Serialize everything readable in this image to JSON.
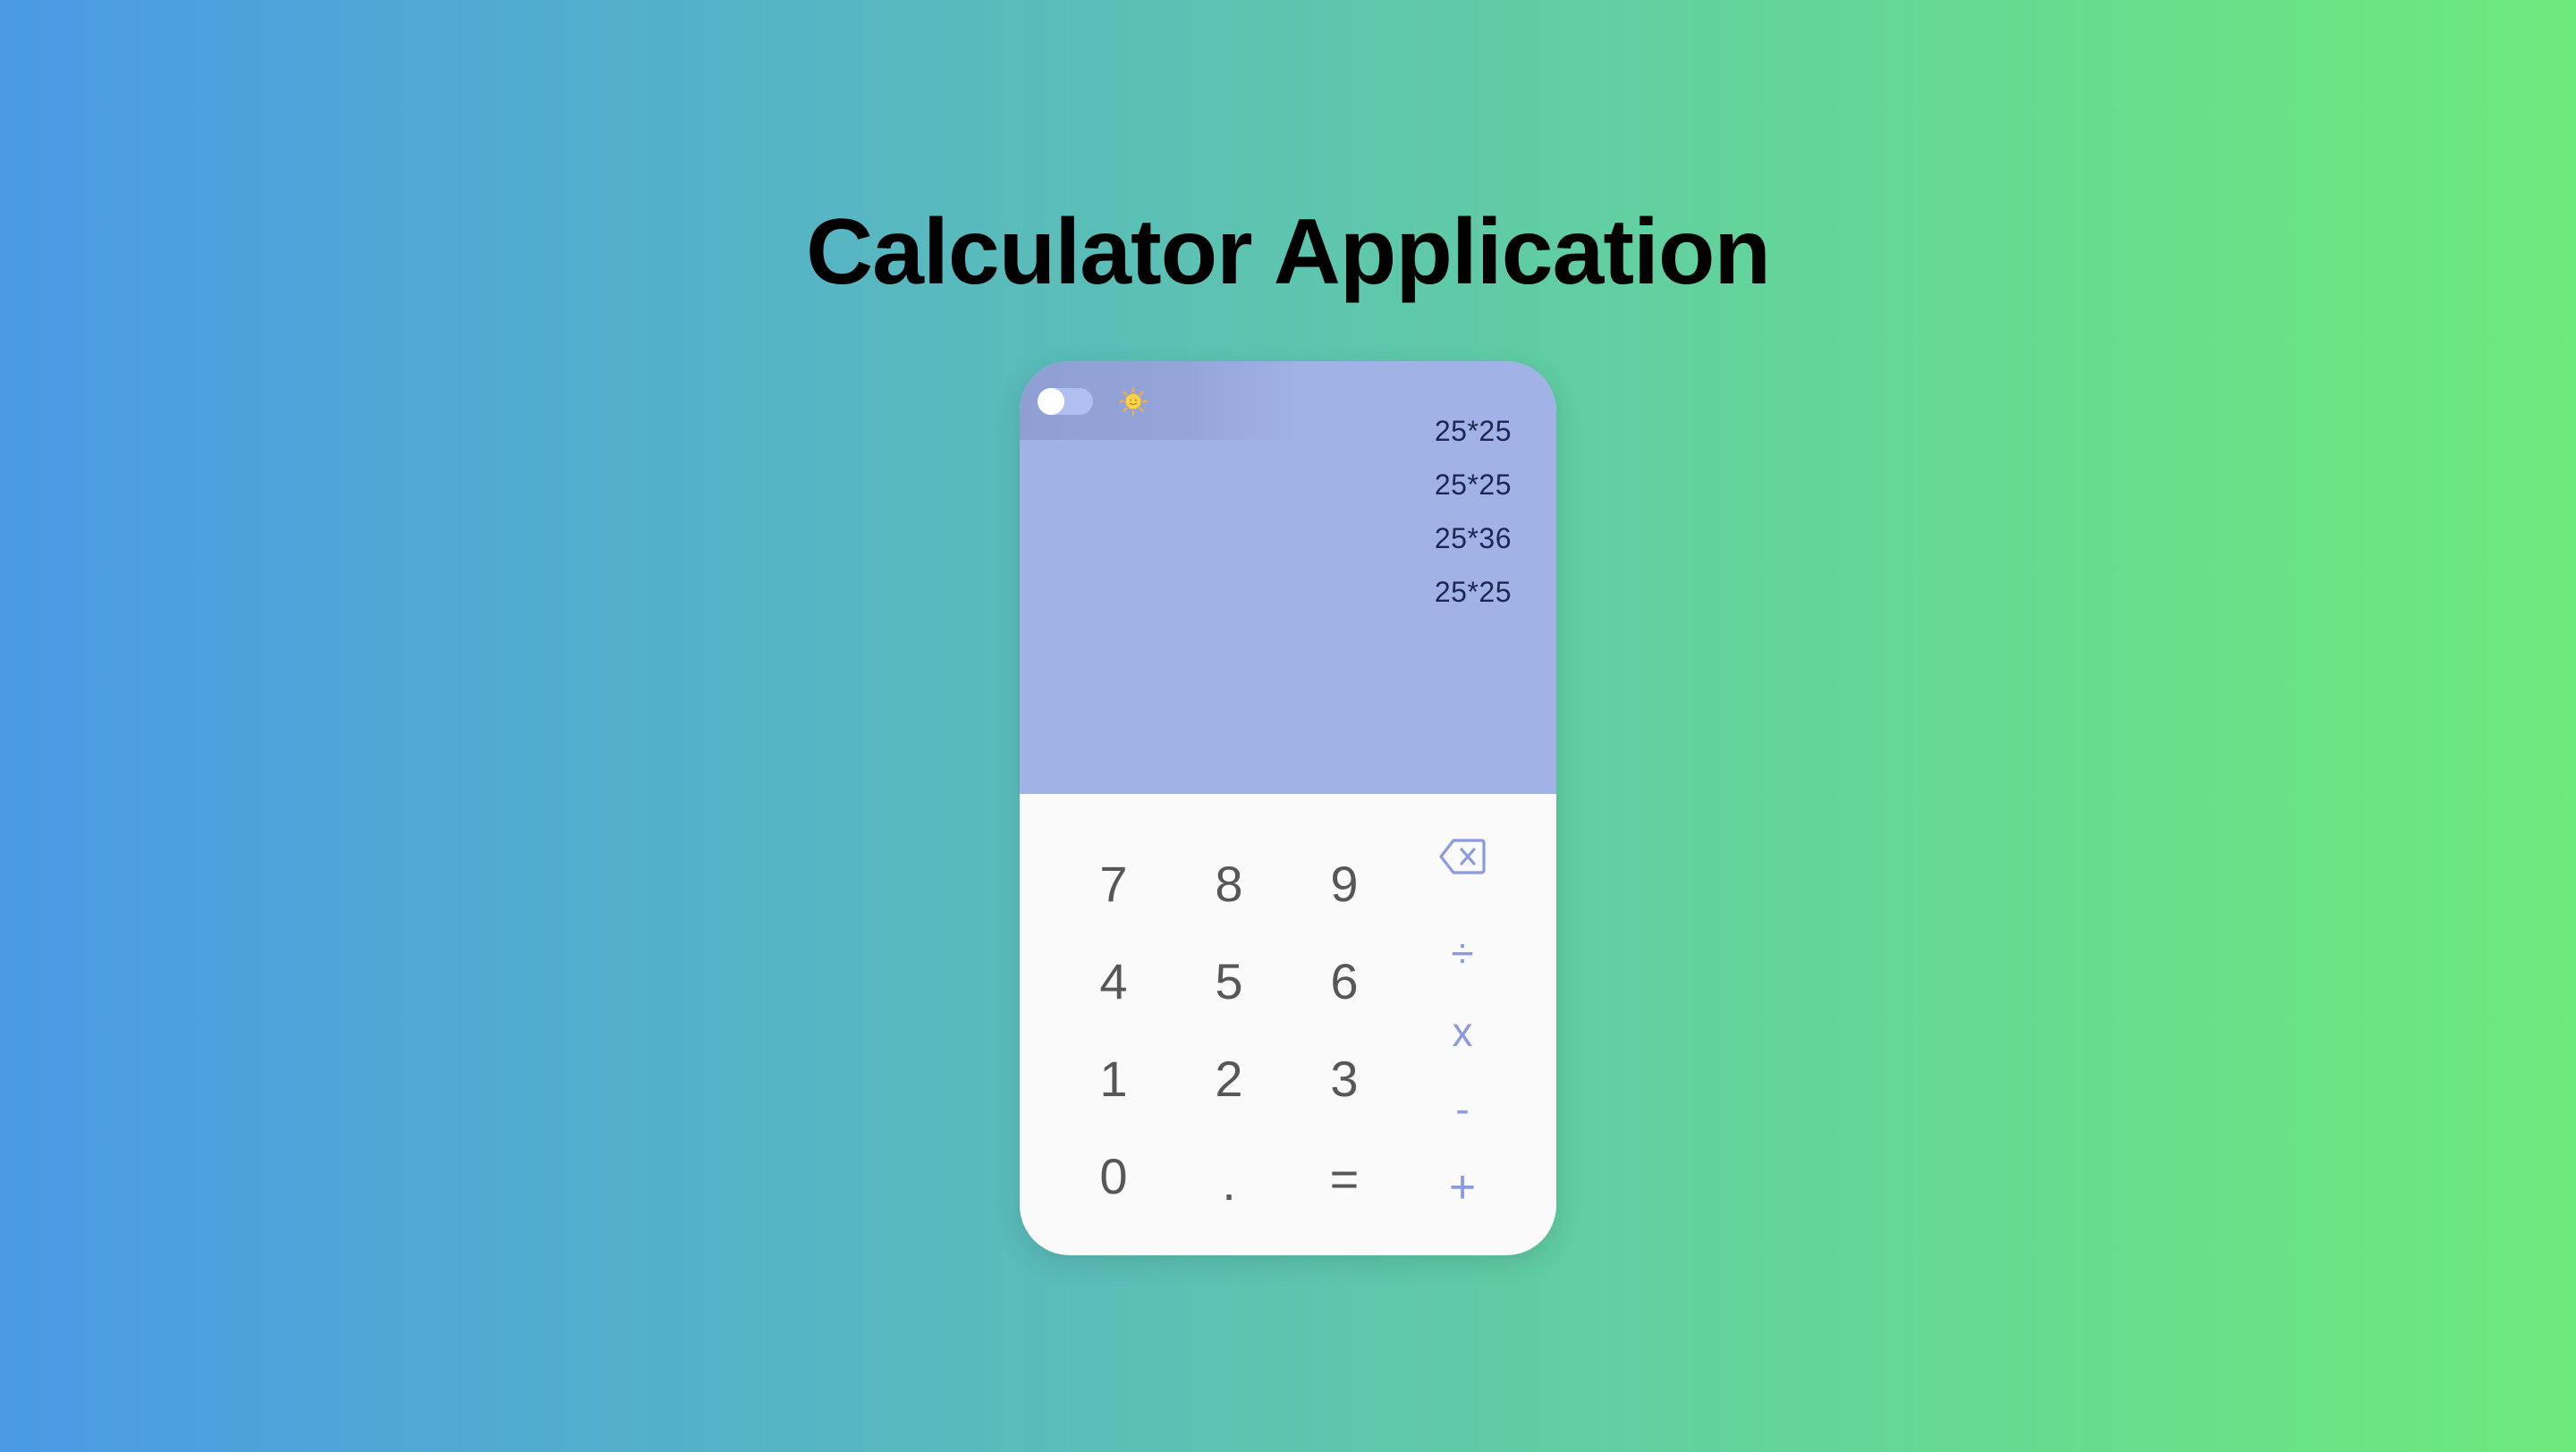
{
  "page": {
    "title": "Calculator Application"
  },
  "theme": {
    "mode": "light",
    "toggle_on": false,
    "icon": "sun-icon"
  },
  "colors": {
    "display_bg": "#a1b2e7",
    "keypad_bg": "#fafafa",
    "operator": "#8a9be3",
    "digit": "#575757",
    "history_text": "#1d2650"
  },
  "history": [
    "25*25",
    "25*25",
    "25*36",
    "25*25"
  ],
  "keys": {
    "seven": "7",
    "eight": "8",
    "nine": "9",
    "four": "4",
    "five": "5",
    "six": "6",
    "one": "1",
    "two": "2",
    "three": "3",
    "zero": "0",
    "decimal": ".",
    "equals": "="
  },
  "operators": {
    "backspace_icon": "backspace-icon",
    "divide": "÷",
    "multiply": "x",
    "subtract": "-",
    "add": "+"
  }
}
